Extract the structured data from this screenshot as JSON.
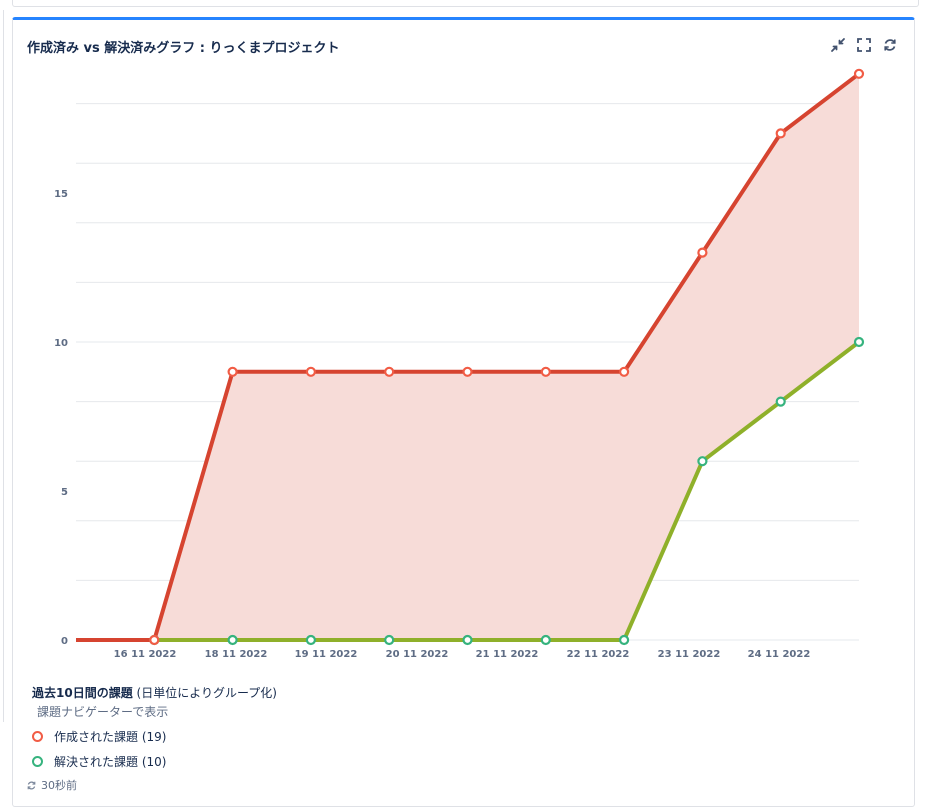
{
  "gadget": {
    "title": "作成済み vs 解決済みグラフ : りっくまプロジェクト",
    "accent_color": "#2684ff",
    "controls": [
      "minimize-icon",
      "fullscreen-icon",
      "refresh-icon"
    ]
  },
  "legend": {
    "title_bold": "過去10日間の課題",
    "title_rest": " (日単位によりグループ化)",
    "navigator_link": "課題ナビゲーターで表示",
    "items": [
      {
        "label": "作成された課題 (19)",
        "color": "#f15c45"
      },
      {
        "label": "解決された課題 (10)",
        "color": "#36b37e"
      }
    ]
  },
  "footer": {
    "updated": "30秒前",
    "icon": "refresh-icon"
  },
  "chart_data": {
    "type": "area",
    "x_tick_labels": [
      "16 11 2022",
      "18 11 2022",
      "19 11 2022",
      "20 11 2022",
      "21 11 2022",
      "22 11 2022",
      "23 11 2022",
      "24 11 2022"
    ],
    "y_ticks": [
      0,
      5,
      10,
      15
    ],
    "ylim": [
      0,
      18
    ],
    "grid": true,
    "series": [
      {
        "name": "作成された課題",
        "color": "#d64430",
        "marker_color": "#f15c45",
        "points": [
          [
            "15 11 2022",
            0
          ],
          [
            "16 11 2022",
            0
          ],
          [
            "17 11 2022",
            9
          ],
          [
            "18 11 2022",
            9
          ],
          [
            "19 11 2022",
            9
          ],
          [
            "20 11 2022",
            9
          ],
          [
            "21 11 2022",
            9
          ],
          [
            "22 11 2022",
            9
          ],
          [
            "23 11 2022",
            13
          ],
          [
            "24 11 2022",
            17
          ],
          [
            "25 11 2022",
            19
          ]
        ]
      },
      {
        "name": "解決された課題",
        "color": "#8fb02a",
        "marker_color": "#36b37e",
        "points": [
          [
            "15 11 2022",
            0
          ],
          [
            "16 11 2022",
            0
          ],
          [
            "17 11 2022",
            0
          ],
          [
            "18 11 2022",
            0
          ],
          [
            "19 11 2022",
            0
          ],
          [
            "20 11 2022",
            0
          ],
          [
            "21 11 2022",
            0
          ],
          [
            "22 11 2022",
            0
          ],
          [
            "23 11 2022",
            6
          ],
          [
            "24 11 2022",
            8
          ],
          [
            "25 11 2022",
            10
          ]
        ]
      }
    ],
    "fill_color": "#f7dcd8"
  }
}
